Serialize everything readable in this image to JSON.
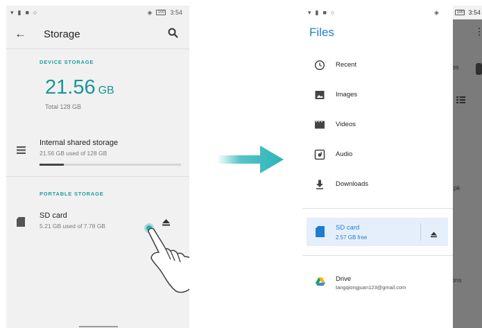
{
  "left_screen": {
    "statusbar": {
      "icons": [
        "wifi-icon",
        "sim-icon",
        "lock-icon",
        "shield-icon"
      ],
      "vibrate": "vibrate-icon",
      "battery": "battery-icon",
      "battery_text": "100",
      "time": "3:54"
    },
    "appbar": {
      "title": "Storage",
      "back": "arrow-left-icon",
      "search": "search-icon"
    },
    "device_storage": {
      "section_label": "DEVICE STORAGE",
      "used_value": "21.56",
      "used_unit": "GB",
      "total": "Total 128 GB",
      "items": [
        {
          "icon": "list-icon",
          "title": "Internal shared storage",
          "subtitle": "21.56 GB used of 128 GB",
          "progress": 0.17
        }
      ]
    },
    "portable_storage": {
      "section_label": "PORTABLE STORAGE",
      "items": [
        {
          "icon": "sd-card-icon",
          "title": "SD card",
          "subtitle": "5.21 GB used of 7.78 GB",
          "action_icon": "eject-icon"
        }
      ]
    }
  },
  "right_screen": {
    "statusbar": {
      "icons": [
        "wifi-icon",
        "sim-icon",
        "lock-icon",
        "shield-icon"
      ],
      "vibrate": "vibrate-icon",
      "battery": "battery-icon",
      "battery_text": "100",
      "time": "3:54"
    },
    "drawer": {
      "title": "Files",
      "items": [
        {
          "icon": "clock-icon",
          "label": "Recent"
        },
        {
          "icon": "image-icon",
          "label": "Images"
        },
        {
          "icon": "video-icon",
          "label": "Videos"
        },
        {
          "icon": "audio-icon",
          "label": "Audio"
        },
        {
          "icon": "download-icon",
          "label": "Downloads"
        }
      ],
      "sd_card": {
        "icon": "sd-card-icon",
        "label": "SD card",
        "sub": "2.57 GB free",
        "action_icon": "eject-icon"
      },
      "drive": {
        "icon": "google-drive-icon",
        "label": "Drive",
        "account": "tangqiongjuan123@gmail.com"
      }
    },
    "background_fragments": [
      "os",
      "pk",
      "ons"
    ]
  },
  "colors": {
    "teal": "#1f9ea0",
    "blue": "#1f7ccf",
    "scrim": "#7b7b7b",
    "arrow": "#2bb5b9"
  }
}
